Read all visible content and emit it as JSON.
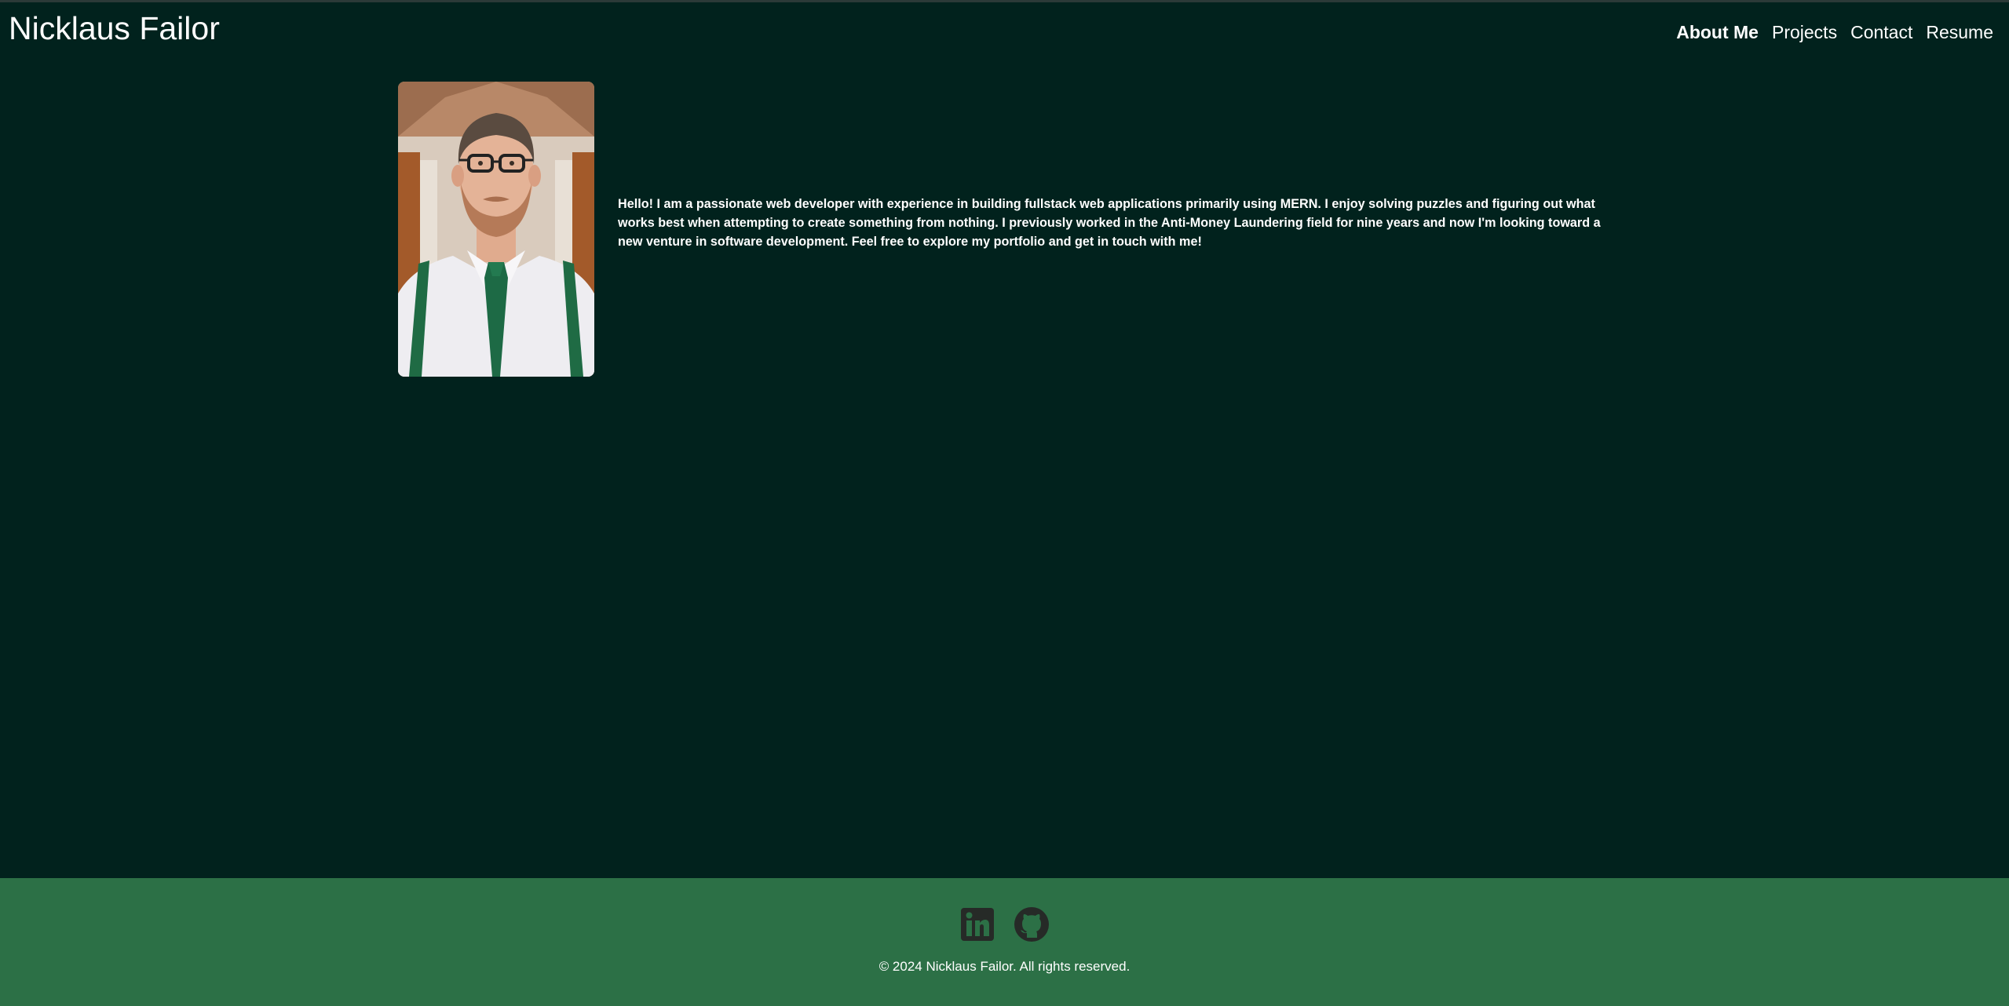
{
  "header": {
    "title": "Nicklaus Failor"
  },
  "nav": {
    "items": [
      {
        "label": "About Me",
        "active": true
      },
      {
        "label": "Projects",
        "active": false
      },
      {
        "label": "Contact",
        "active": false
      },
      {
        "label": "Resume",
        "active": false
      }
    ]
  },
  "about": {
    "bio": "Hello! I am a passionate web developer with experience in building fullstack web applications primarily using MERN. I enjoy solving puzzles and figuring out what works best when attempting to create something from nothing. I previously worked in the Anti-Money Laundering field for nine years and now I'm looking toward a new venture in software development. Feel free to explore my portfolio and get in touch with me!"
  },
  "footer": {
    "social_icons": [
      "linkedin-icon",
      "github-icon"
    ],
    "copyright": "© 2024 Nicklaus Failor. All rights reserved."
  },
  "colors": {
    "background": "#01221d",
    "footer": "#2c7046",
    "icon": "#262a27",
    "text": "#ffffff"
  }
}
